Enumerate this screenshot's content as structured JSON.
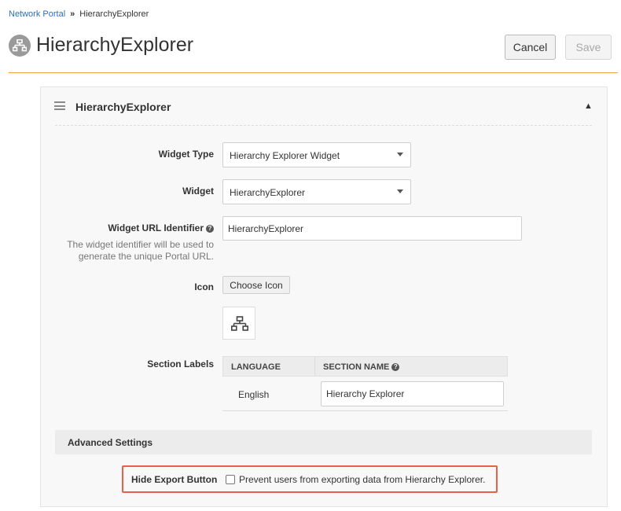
{
  "breadcrumb": {
    "root": "Network Portal",
    "separator": "»",
    "current": "HierarchyExplorer"
  },
  "page": {
    "title": "HierarchyExplorer",
    "title_icon": "hierarchy-icon"
  },
  "actions": {
    "cancel_label": "Cancel",
    "save_label": "Save"
  },
  "panel": {
    "title": "HierarchyExplorer",
    "collapse_glyph": "▲"
  },
  "form": {
    "widget_type": {
      "label": "Widget Type",
      "value": "Hierarchy Explorer Widget"
    },
    "widget": {
      "label": "Widget",
      "value": "HierarchyExplorer"
    },
    "widget_url": {
      "label": "Widget URL Identifier",
      "value": "HierarchyExplorer",
      "help_line1": "The widget identifier will be used to",
      "help_line2": "generate the unique Portal URL."
    },
    "icon": {
      "label": "Icon",
      "button_label": "Choose Icon",
      "selected_icon": "hierarchy-icon"
    },
    "section_labels": {
      "label": "Section Labels",
      "columns": {
        "language": "LANGUAGE",
        "section_name": "SECTION NAME"
      },
      "rows": [
        {
          "language": "English",
          "section_name": "Hierarchy Explorer"
        }
      ]
    }
  },
  "advanced": {
    "title": "Advanced Settings",
    "hide_export": {
      "label": "Hide Export Button",
      "checkbox_label": "Prevent users from exporting data from Hierarchy Explorer.",
      "checked": false
    }
  },
  "colors": {
    "link": "#2a6ebb",
    "title_rule": "#e8a53c",
    "highlight_border": "#e8604c"
  }
}
